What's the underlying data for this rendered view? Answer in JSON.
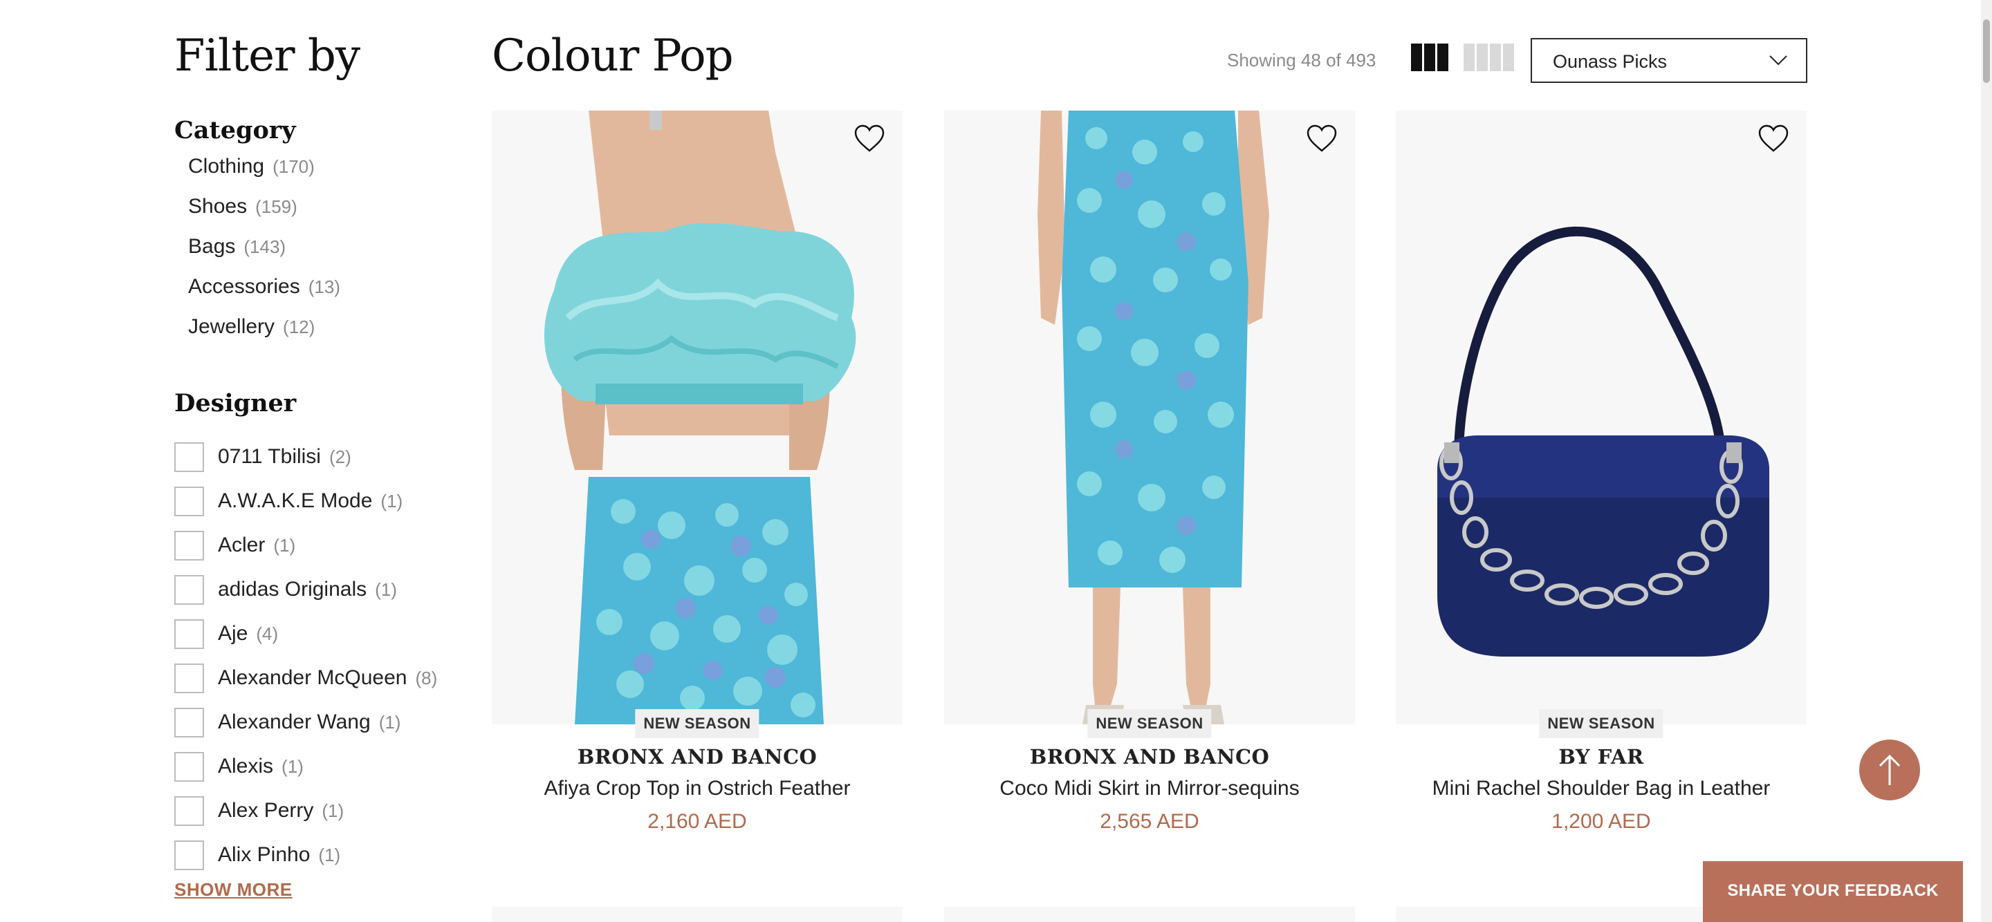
{
  "sidebar": {
    "title": "Filter by",
    "category": {
      "title": "Category",
      "items": [
        {
          "label": "Clothing",
          "count": "(170)"
        },
        {
          "label": "Shoes",
          "count": "(159)"
        },
        {
          "label": "Bags",
          "count": "(143)"
        },
        {
          "label": "Accessories",
          "count": "(13)"
        },
        {
          "label": "Jewellery",
          "count": "(12)"
        }
      ]
    },
    "designer": {
      "title": "Designer",
      "items": [
        {
          "label": "0711 Tbilisi",
          "count": "(2)"
        },
        {
          "label": "A.W.A.K.E Mode",
          "count": "(1)"
        },
        {
          "label": "Acler",
          "count": "(1)"
        },
        {
          "label": "adidas Originals",
          "count": "(1)"
        },
        {
          "label": "Aje",
          "count": "(4)"
        },
        {
          "label": "Alexander McQueen",
          "count": "(8)"
        },
        {
          "label": "Alexander Wang",
          "count": "(1)"
        },
        {
          "label": "Alexis",
          "count": "(1)"
        },
        {
          "label": "Alex Perry",
          "count": "(1)"
        },
        {
          "label": "Alix Pinho",
          "count": "(1)"
        }
      ],
      "show_more": "SHOW MORE"
    }
  },
  "header": {
    "title": "Colour Pop",
    "showing": "Showing 48 of 493",
    "sort": {
      "selected": "Ounass Picks"
    },
    "view_modes": [
      "grid-3-columns",
      "grid-4-columns"
    ],
    "active_view": "grid-3-columns"
  },
  "products": [
    {
      "badge": "NEW SEASON",
      "brand": "BRONX AND BANCO",
      "name": "Afiya Crop Top in Ostrich Feather",
      "price": "2,160 AED"
    },
    {
      "badge": "NEW SEASON",
      "brand": "BRONX AND BANCO",
      "name": "Coco Midi Skirt in Mirror-sequins",
      "price": "2,565 AED"
    },
    {
      "badge": "NEW SEASON",
      "brand": "BY FAR",
      "name": "Mini Rachel Shoulder Bag in Leather",
      "price": "1,200 AED"
    }
  ],
  "floating": {
    "feedback_label": "SHARE YOUR FEEDBACK",
    "scroll_top_icon": "arrow-up-icon"
  },
  "colors": {
    "accent": "#b8705a",
    "price": "#b06a4b",
    "text": "#222222",
    "muted": "#8a8a8a"
  }
}
